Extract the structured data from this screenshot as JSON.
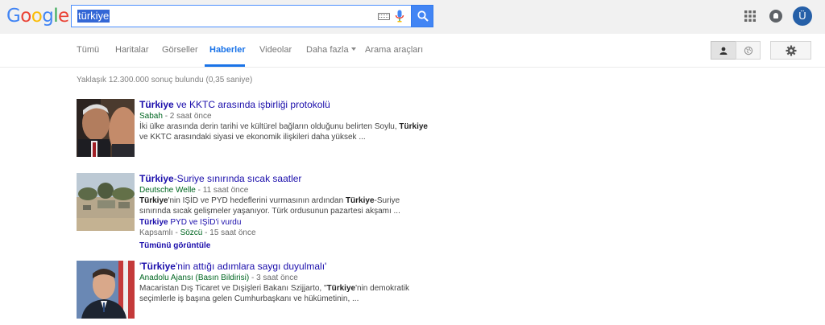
{
  "logo": {
    "letters": [
      "G",
      "o",
      "o",
      "g",
      "l",
      "e"
    ],
    "colors": [
      "#4285f4",
      "#ea4335",
      "#fbbc05",
      "#4285f4",
      "#34a853",
      "#ea4335"
    ]
  },
  "search": {
    "query": "türkiye"
  },
  "header": {
    "avatar_letter": "Ü",
    "accent": "#4285f4"
  },
  "nav": {
    "tabs": [
      {
        "label": "Tümü"
      },
      {
        "label": "Haritalar"
      },
      {
        "label": "Görseller"
      },
      {
        "label": "Haberler",
        "active": true
      },
      {
        "label": "Videolar"
      },
      {
        "label": "Daha fazla"
      },
      {
        "label": "Arama araçları"
      }
    ]
  },
  "results_stats": "Yaklaşık 12.300.000 sonuç bulundu (0,35 saniye)",
  "results": [
    {
      "title_bold": "Türkiye",
      "title_rest": " ve KKTC arasında işbirliği protokolü",
      "source": "Sabah",
      "time": " - 2 saat önce",
      "snippet_a": "İki ülke arasında derin tarihi ve kültürel bağların olduğunu belirten Soylu, ",
      "snippet_b": "Türkiye",
      "snippet_c": " ve KKTC arasındaki siyasi ve ekonomik ilişkileri daha yüksek ..."
    },
    {
      "title_bold": "Türkiye",
      "title_rest": "-Suriye sınırında sıcak saatler",
      "source": "Deutsche Welle",
      "time": " - 11 saat önce",
      "snippet_a": "Türkiye",
      "snippet_b": "'nin IŞİD ve PYD hedeflerini vurmasının ardından ",
      "snippet_c": "Türkiye",
      "snippet_d": "-Suriye sınırında sıcak gelişmeler yaşanıyor. Türk ordusunun pazartesi akşamı ...",
      "sub_title_bold": "Türkiye",
      "sub_title_rest": " PYD ve IŞİD'i vurdu",
      "sub_prefix": "Kapsamlı - ",
      "sub_source": "Sözcü",
      "sub_time": " - 15 saat önce",
      "view_all": "Tümünü görüntüle"
    },
    {
      "title_pre": "'",
      "title_bold": "Türkiye",
      "title_rest": "'nin attığı adımlara saygı duyulmalı'",
      "source": "Anadolu Ajansı (Basın Bildirisi)",
      "time": " - 3 saat önce",
      "snippet_a": "Macaristan Dış Ticaret ve Dışişleri Bakanı Szijjarto, \"",
      "snippet_b": "Türkiye",
      "snippet_c": "'nin demokratik seçimlerle iş başına gelen Cumhurbaşkanı ve hükümetinin, ..."
    }
  ]
}
